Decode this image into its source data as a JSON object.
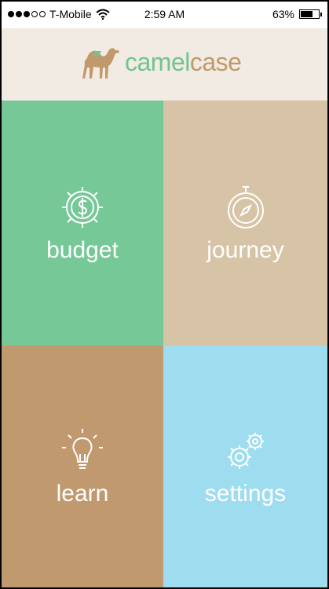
{
  "status_bar": {
    "carrier": "T-Mobile",
    "time": "2:59 AM",
    "battery": "63%",
    "battery_level": 0.63,
    "signal_bars_filled": 3,
    "signal_bars_total": 5
  },
  "header": {
    "logo_part1": "camel",
    "logo_part2": "case"
  },
  "tiles": [
    {
      "label": "budget",
      "icon": "dollar-gear-icon",
      "color": "#76c897"
    },
    {
      "label": "journey",
      "icon": "stopwatch-compass-icon",
      "color": "#d7c4a6"
    },
    {
      "label": "learn",
      "icon": "lightbulb-icon",
      "color": "#c1996e"
    },
    {
      "label": "settings",
      "icon": "gears-icon",
      "color": "#9edcef"
    }
  ],
  "colors": {
    "header_bg": "#f1ebe3",
    "logo_green": "#71c391",
    "logo_tan": "#c19a6b"
  }
}
